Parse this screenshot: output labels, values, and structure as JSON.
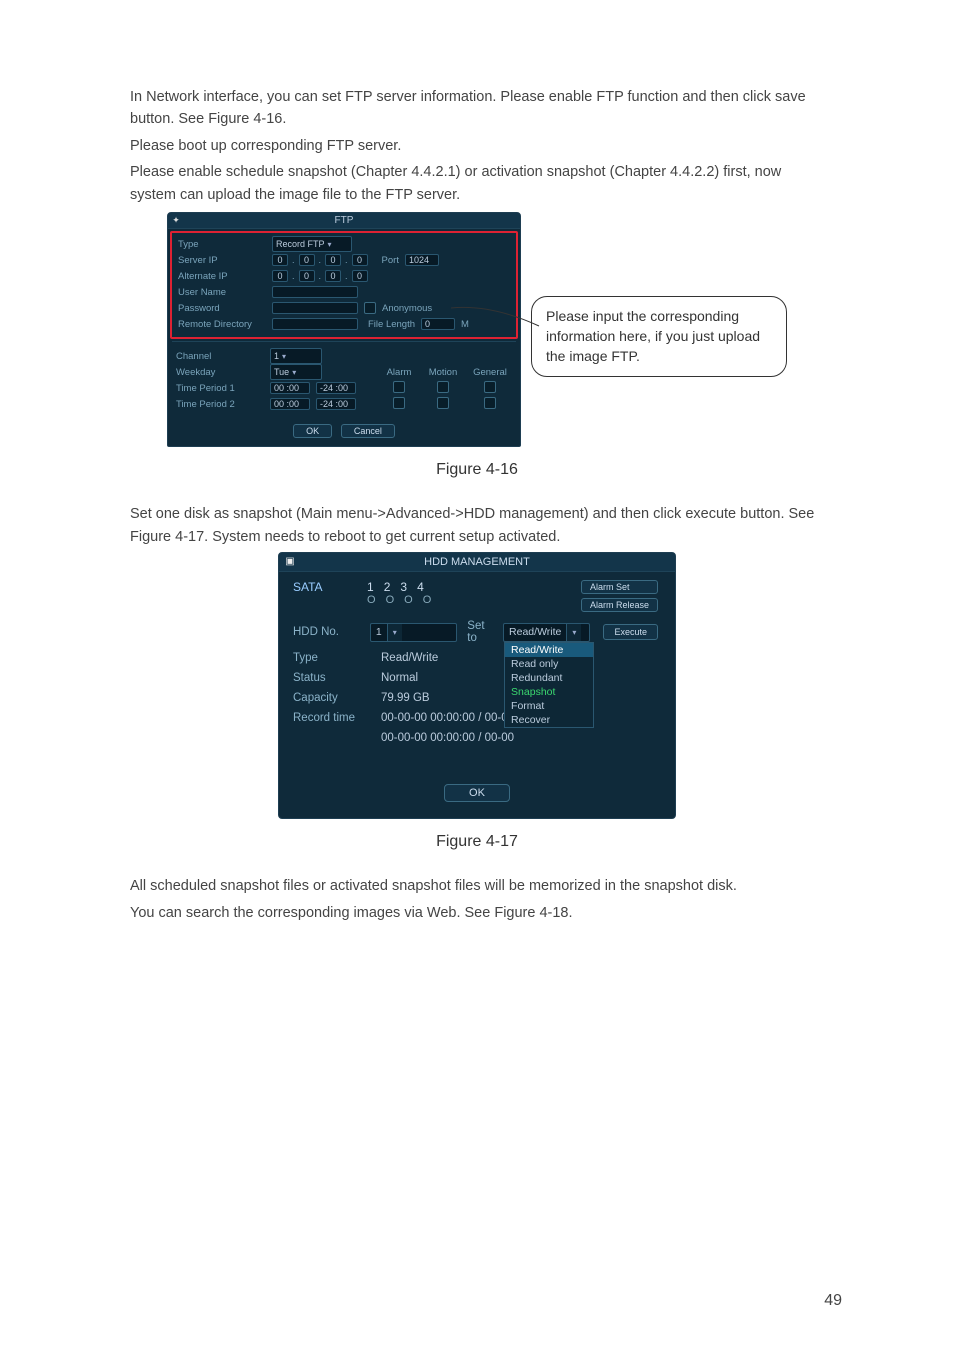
{
  "text": {
    "p1": "In Network interface, you can set FTP server information. Please enable FTP function and then click save button. See Figure 4-16.",
    "p2": "Please boot up corresponding FTP server.",
    "p3": "Please enable schedule snapshot (Chapter 4.4.2.1) or activation snapshot (Chapter 4.4.2.2) first, now system can upload the image file to the FTP server.",
    "caption_416": "Figure 4-16",
    "p4": "Set one disk as snapshot (Main menu->Advanced->HDD management) and then click execute button. See Figure 4-17. System needs to reboot to get current setup activated.",
    "caption_417": "Figure 4-17",
    "p5": "All scheduled snapshot files or activated snapshot files will be memorized in the snapshot disk.",
    "p6": "You can search the corresponding images via Web. See Figure 4-18.",
    "page_number": "49"
  },
  "callout": "Please input the corresponding information here, if you just upload the image FTP.",
  "ftp": {
    "title": "FTP",
    "labels": {
      "type": "Type",
      "server_ip": "Server IP",
      "alternate_ip": "Alternate IP",
      "user_name": "User Name",
      "password": "Password",
      "remote_directory": "Remote Directory",
      "channel": "Channel",
      "weekday": "Weekday",
      "time_period_1": "Time Period 1",
      "time_period_2": "Time Period 2",
      "port": "Port",
      "anonymous": "Anonymous",
      "file_length": "File Length",
      "file_length_unit": "M",
      "alarm": "Alarm",
      "motion": "Motion",
      "general": "General"
    },
    "values": {
      "type_value": "Record FTP",
      "ip": [
        "0",
        "0",
        "0",
        "0"
      ],
      "alt_ip": [
        "0",
        "0",
        "0",
        "0"
      ],
      "port": "1024",
      "file_length": "0",
      "channel": "1",
      "weekday": "Tue",
      "tp1_from": "00 :00",
      "tp1_to": "-24 :00",
      "tp2_from": "00 :00",
      "tp2_to": "-24 :00"
    },
    "buttons": {
      "ok": "OK",
      "cancel": "Cancel"
    }
  },
  "hdd": {
    "title": "HDD MANAGEMENT",
    "labels": {
      "sata": "SATA",
      "hdd_no": "HDD No.",
      "set_to": "Set to",
      "type": "Type",
      "status": "Status",
      "capacity": "Capacity",
      "record_time": "Record time"
    },
    "sata_cols": [
      "1",
      "2",
      "3",
      "4"
    ],
    "sata_dots": [
      "O",
      "O",
      "O",
      "O"
    ],
    "buttons": {
      "alarm_set": "Alarm Set",
      "alarm_release": "Alarm Release",
      "execute": "Execute",
      "ok": "OK"
    },
    "values": {
      "hdd_no": "1",
      "set_to_selected": "Read/Write",
      "type": "Read/Write",
      "status": "Normal",
      "capacity": "79.99 GB",
      "record_time_1": "00-00-00 00:00:00 / 00-00",
      "record_time_2": "00-00-00 00:00:00 / 00-00"
    },
    "dropdown_options": [
      "Read/Write",
      "Read only",
      "Redundant",
      "Snapshot",
      "Format",
      "Recover"
    ]
  }
}
